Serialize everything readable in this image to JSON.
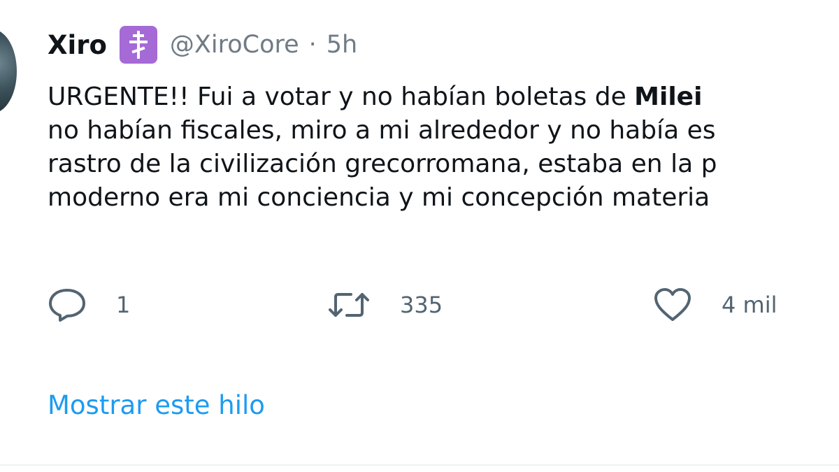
{
  "tweet": {
    "display_name": "Xiro",
    "badge_icon": "orthodox-cross-icon",
    "badge_color": "#a56ad6",
    "handle": "@XiroCore",
    "separator": "·",
    "time": "5h",
    "text_lines": [
      {
        "before": "URGENTE!! Fui a votar y no habían boletas de ",
        "bold": "Milei",
        "after": ""
      },
      {
        "before": "no habían fiscales, miro a mi alrededor y no había es",
        "bold": "",
        "after": ""
      },
      {
        "before": "rastro de la civilización grecorromana, estaba en la p",
        "bold": "",
        "after": ""
      },
      {
        "before": "moderno era mi conciencia y mi concepción materia",
        "bold": "",
        "after": ""
      }
    ],
    "actions": {
      "reply": {
        "icon": "reply-icon",
        "count": "1"
      },
      "retweet": {
        "icon": "retweet-icon",
        "count": "335"
      },
      "like": {
        "icon": "heart-icon",
        "count": "4 mil"
      }
    },
    "show_thread": "Mostrar este hilo",
    "link_color": "#1d9bf0"
  }
}
